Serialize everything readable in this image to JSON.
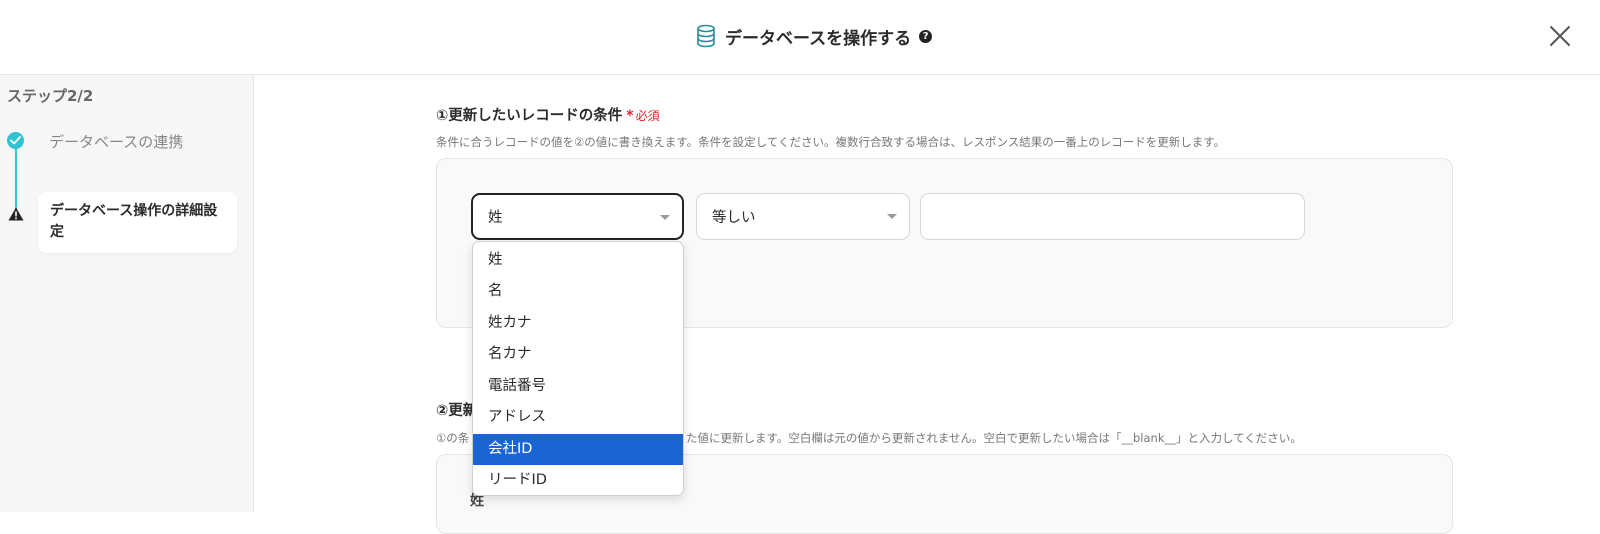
{
  "header": {
    "title": "データベースを操作する",
    "icon": "database-icon",
    "help_icon_glyph": "?",
    "close_icon": "close-icon"
  },
  "sidebar": {
    "step_count": "ステップ2/2",
    "steps": [
      {
        "label": "データベースの連携",
        "status": "complete",
        "icon": "check-circle-icon"
      },
      {
        "label": "データベース操作の詳細設定",
        "status": "warning",
        "icon": "warning-icon"
      }
    ]
  },
  "section1": {
    "title": "①更新したいレコードの条件",
    "required_star": "*",
    "required_text": "必須",
    "description": "条件に合うレコードの値を②の値に書き換えます。条件を設定してください。複数行合致する場合は、レスポンス結果の一番上のレコードを更新します。",
    "field_select": {
      "value": "姓"
    },
    "operator_select": {
      "value": "等しい"
    },
    "value_input": {
      "value": ""
    }
  },
  "dropdown": {
    "options": [
      "姓",
      "名",
      "姓カナ",
      "名カナ",
      "電話番号",
      "アドレス",
      "会社ID",
      "リードID"
    ],
    "highlighted_index": 6
  },
  "section2": {
    "title_visible": "②更新",
    "description_left": "①の条",
    "description_right": "た値に更新します。空白欄は元の値から更新されません。空白で更新したい場合は「__blank__」と入力してください。",
    "first_field_label": "姓"
  },
  "colors": {
    "accent": "#1a64d3",
    "step_complete": "#2ec4d6",
    "required": "#e0242e"
  }
}
